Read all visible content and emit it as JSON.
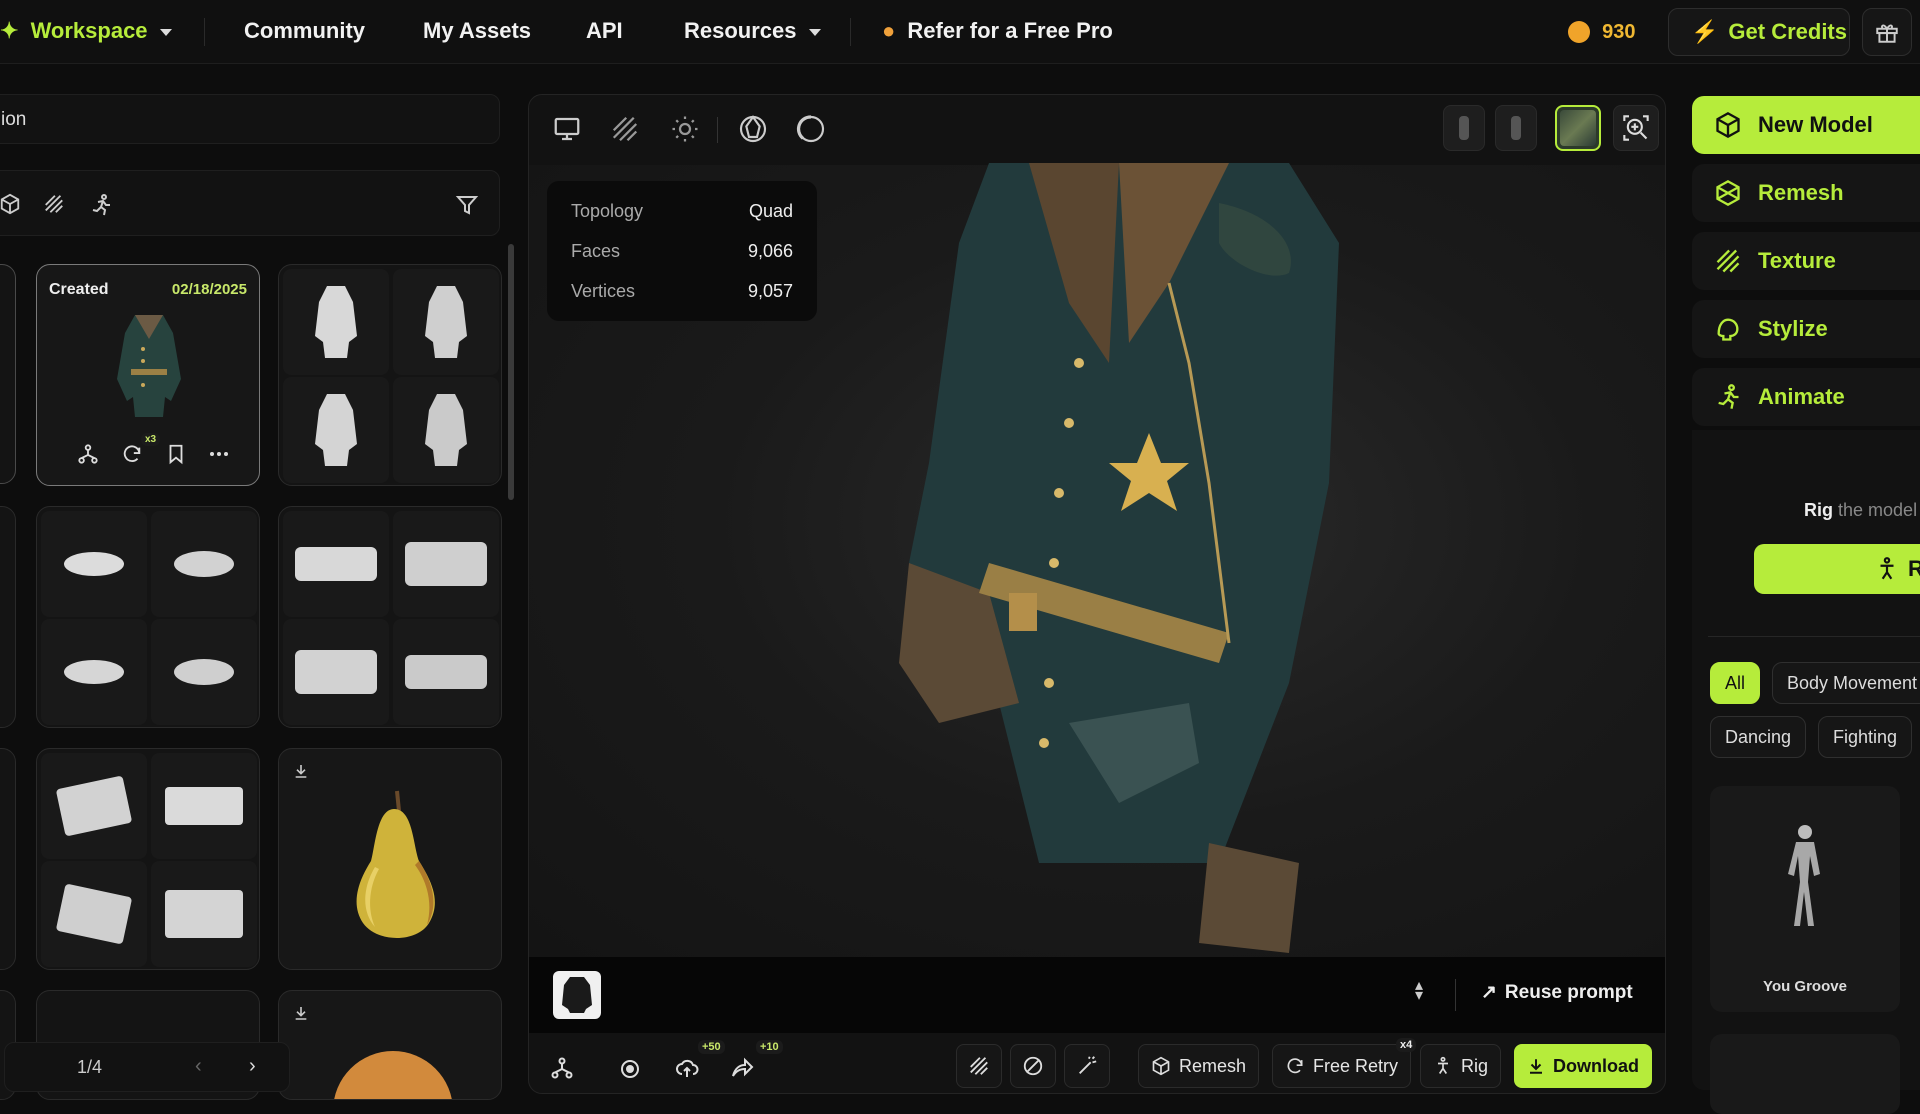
{
  "topbar": {
    "workspace_label": "Workspace",
    "community_label": "Community",
    "my_assets_label": "My Assets",
    "api_label": "API",
    "resources_label": "Resources",
    "refer_label": "Refer for a Free Pro",
    "credits_count": "930",
    "get_credits_label": "Get Credits"
  },
  "left_panel": {
    "search_partial_text": "ion",
    "selected_card": {
      "status_label": "Created",
      "date": "02/18/2025",
      "retry_count_badge": "x3"
    },
    "pagination": {
      "page_label": "1/4"
    }
  },
  "viewer": {
    "stats": [
      {
        "label": "Topology",
        "value": "Quad"
      },
      {
        "label": "Faces",
        "value": "9,066"
      },
      {
        "label": "Vertices",
        "value": "9,057"
      }
    ],
    "reuse_prompt_label": "Reuse prompt",
    "bottom_toolbar": {
      "badge_upload": "+50",
      "badge_share": "+10",
      "remesh_label": "Remesh",
      "free_retry_label": "Free Retry",
      "free_retry_badge": "x4",
      "rig_label": "Rig",
      "download_label": "Download"
    }
  },
  "right_panel": {
    "new_model_label": "New Model",
    "remesh_label": "Remesh",
    "texture_label": "Texture",
    "stylize_label": "Stylize",
    "animate_label": "Animate",
    "rig_hint_bold": "Rig",
    "rig_hint_rest": "the model",
    "rig_button_partial": "R",
    "filters": [
      "All",
      "Body Movement",
      "Dancing",
      "Fighting"
    ],
    "animation_card_label": "You Groove"
  },
  "colors": {
    "accent": "#b6ec3b",
    "background": "#0d0d0d",
    "panel": "#121212"
  }
}
